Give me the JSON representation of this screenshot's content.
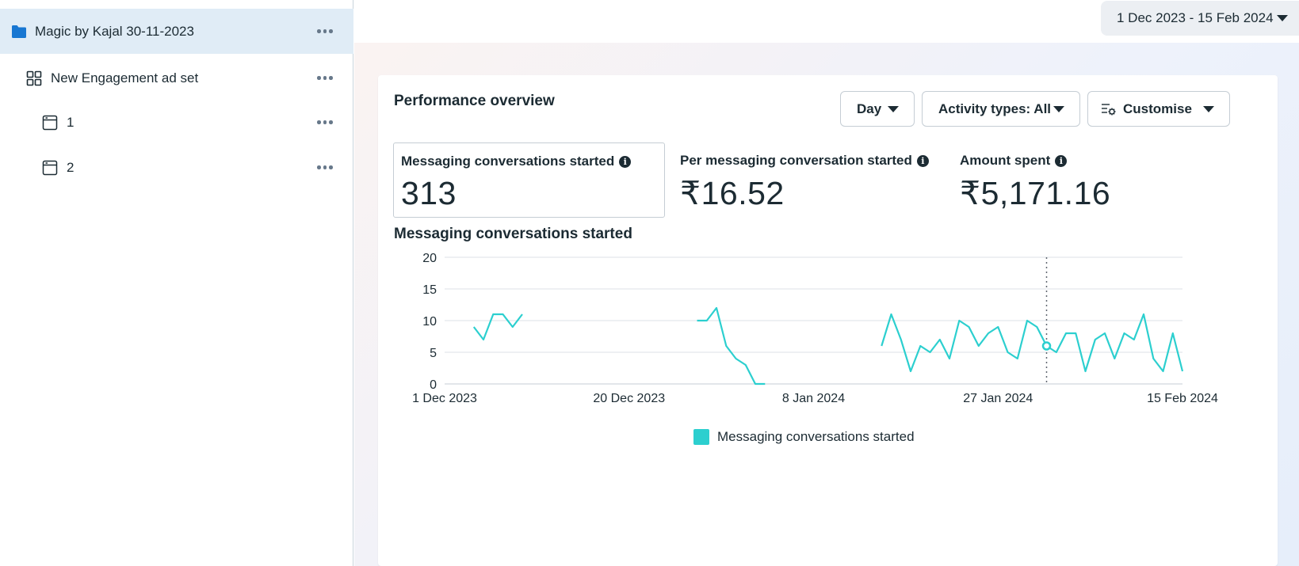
{
  "sidebar": {
    "items": [
      {
        "label": "Magic by Kajal 30-11-2023",
        "icon": "folder-icon"
      },
      {
        "label": "New Engagement ad set",
        "icon": "grid-icon"
      },
      {
        "label": "1",
        "icon": "ad-icon"
      },
      {
        "label": "2",
        "icon": "ad-icon"
      }
    ]
  },
  "topbar": {
    "date_range": "1 Dec 2023 - 15 Feb 2024"
  },
  "card": {
    "title": "Performance overview",
    "controls": {
      "day": "Day",
      "activity": "Activity types: All",
      "customise": "Customise"
    },
    "metrics": [
      {
        "label": "Messaging conversations started",
        "value": "313"
      },
      {
        "label": "Per messaging conversation started",
        "value": "₹16.52"
      },
      {
        "label": "Amount spent",
        "value": "₹5,171.16"
      }
    ]
  },
  "chart_data": {
    "type": "line",
    "title": "Messaging conversations started",
    "xlabel": "",
    "ylabel": "",
    "ylim": [
      0,
      20
    ],
    "yticks": [
      0,
      5,
      10,
      15,
      20
    ],
    "xtick_labels": [
      "1 Dec 2023",
      "20 Dec 2023",
      "8 Jan 2024",
      "27 Jan 2024",
      "15 Feb 2024"
    ],
    "grid": true,
    "legend": "bottom",
    "color": "#2ccfcf",
    "highlight_date": "2024-02-01",
    "series": [
      {
        "name": "Messaging conversations started",
        "segments": [
          {
            "x": [
              "2023-12-04",
              "2023-12-05",
              "2023-12-06",
              "2023-12-07",
              "2023-12-08",
              "2023-12-09"
            ],
            "y": [
              9,
              7,
              11,
              11,
              9,
              11
            ]
          },
          {
            "x": [
              "2023-12-27",
              "2023-12-28",
              "2023-12-29",
              "2023-12-30",
              "2023-12-31",
              "2024-01-01",
              "2024-01-02",
              "2024-01-03"
            ],
            "y": [
              10,
              10,
              12,
              6,
              4,
              3,
              0,
              0
            ]
          },
          {
            "x": [
              "2024-01-15",
              "2024-01-16",
              "2024-01-17",
              "2024-01-18",
              "2024-01-19",
              "2024-01-20",
              "2024-01-21",
              "2024-01-22",
              "2024-01-23",
              "2024-01-24",
              "2024-01-25",
              "2024-01-26",
              "2024-01-27",
              "2024-01-28",
              "2024-01-29",
              "2024-01-30",
              "2024-01-31",
              "2024-02-01",
              "2024-02-02",
              "2024-02-03",
              "2024-02-04",
              "2024-02-05",
              "2024-02-06",
              "2024-02-07",
              "2024-02-08",
              "2024-02-09",
              "2024-02-10",
              "2024-02-11",
              "2024-02-12",
              "2024-02-13",
              "2024-02-14",
              "2024-02-15"
            ],
            "y": [
              6,
              11,
              7,
              2,
              6,
              5,
              7,
              4,
              10,
              9,
              6,
              8,
              9,
              5,
              4,
              10,
              9,
              6,
              5,
              8,
              8,
              2,
              7,
              8,
              4,
              8,
              7,
              11,
              4,
              2,
              8,
              2
            ]
          }
        ]
      }
    ]
  }
}
